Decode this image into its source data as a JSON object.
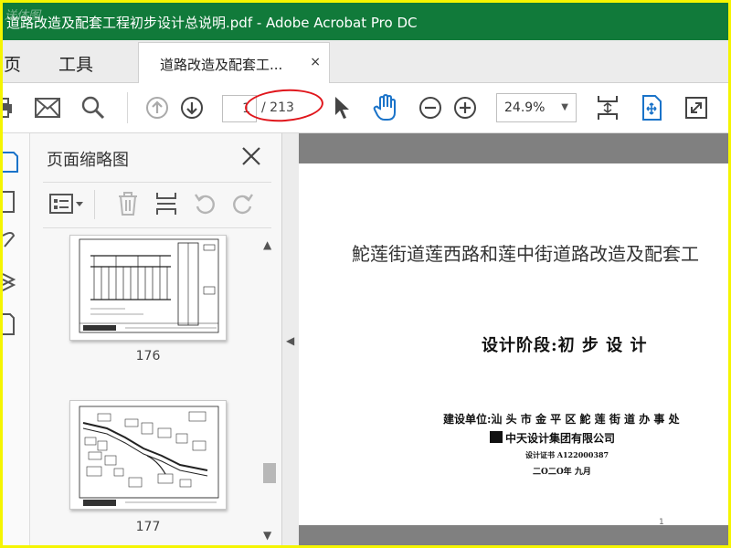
{
  "window": {
    "title": "道路改造及配套工程初步设计总说明.pdf - Adobe Acrobat Pro DC",
    "watermark": "送体图"
  },
  "tabs": {
    "home_label": "主页",
    "tools_label": "工具",
    "document_tab_label": "道路改造及配套工...",
    "close_glyph": "×"
  },
  "toolbar": {
    "current_page": "1",
    "page_total": "/ 213",
    "zoom": "24.9%"
  },
  "thumbnail_panel": {
    "title": "页面缩略图",
    "thumbnails": [
      {
        "page": "176"
      },
      {
        "page": "177"
      }
    ]
  },
  "document": {
    "title": "鮀莲街道莲西路和莲中街道路改造及配套工",
    "stage": "设计阶段:初 步 设 计",
    "builder": "建设单位:汕 头 市 金 平 区 鮀 莲 街 道 办 事 处",
    "designer": "中天设计集团有限公司",
    "certificate": "设计证书 A122000387",
    "date": "二O二O年 九月",
    "page_number": "1"
  },
  "colors": {
    "titlebar": "#117a3a",
    "accent_blue": "#1a73c9",
    "annotation_red": "#e0161c",
    "highlight_frame": "#f5f500"
  }
}
